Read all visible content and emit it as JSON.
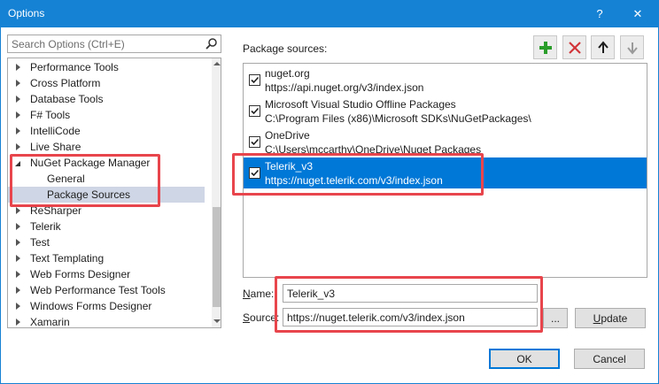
{
  "window": {
    "title": "Options",
    "help_label": "?",
    "close_label": "✕"
  },
  "search": {
    "placeholder": "Search Options (Ctrl+E)"
  },
  "tree": {
    "items": [
      {
        "label": "Performance Tools",
        "state": "collapsed"
      },
      {
        "label": "Cross Platform",
        "state": "collapsed"
      },
      {
        "label": "Database Tools",
        "state": "collapsed"
      },
      {
        "label": "F# Tools",
        "state": "collapsed"
      },
      {
        "label": "IntelliCode",
        "state": "collapsed"
      },
      {
        "label": "Live Share",
        "state": "collapsed"
      },
      {
        "label": "NuGet Package Manager",
        "state": "expanded"
      },
      {
        "label": "General",
        "state": "child"
      },
      {
        "label": "Package Sources",
        "state": "child-selected"
      },
      {
        "label": "ReSharper",
        "state": "collapsed"
      },
      {
        "label": "Telerik",
        "state": "collapsed"
      },
      {
        "label": "Test",
        "state": "collapsed"
      },
      {
        "label": "Text Templating",
        "state": "collapsed"
      },
      {
        "label": "Web Forms Designer",
        "state": "collapsed"
      },
      {
        "label": "Web Performance Test Tools",
        "state": "collapsed"
      },
      {
        "label": "Windows Forms Designer",
        "state": "collapsed"
      },
      {
        "label": "Xamarin",
        "state": "collapsed"
      }
    ]
  },
  "sources": {
    "heading": "Package sources:",
    "items": [
      {
        "name": "nuget.org",
        "url": "https://api.nuget.org/v3/index.json",
        "checked": true,
        "selected": false
      },
      {
        "name": "Microsoft Visual Studio Offline Packages",
        "url": "C:\\Program Files (x86)\\Microsoft SDKs\\NuGetPackages\\",
        "checked": true,
        "selected": false
      },
      {
        "name": "OneDrive",
        "url": "C:\\Users\\mccarthy\\OneDrive\\Nuget Packages",
        "checked": true,
        "selected": false
      },
      {
        "name": "Telerik_v3",
        "url": "https://nuget.telerik.com/v3/index.json",
        "checked": true,
        "selected": true
      }
    ]
  },
  "form": {
    "name_label_u": "N",
    "name_label_rest": "ame:",
    "name_value": "Telerik_v3",
    "source_label_u": "S",
    "source_label_rest": "ource:",
    "source_value": "https://nuget.telerik.com/v3/index.json",
    "browse_label": "...",
    "update_label_u": "U",
    "update_label_rest": "pdate"
  },
  "footer": {
    "ok_label": "OK",
    "cancel_label": "Cancel"
  },
  "colors": {
    "titlebar": "#1682d4",
    "selection": "#0078d7",
    "highlight": "#e8454c",
    "add": "#2a9d2a",
    "remove": "#d13438"
  }
}
